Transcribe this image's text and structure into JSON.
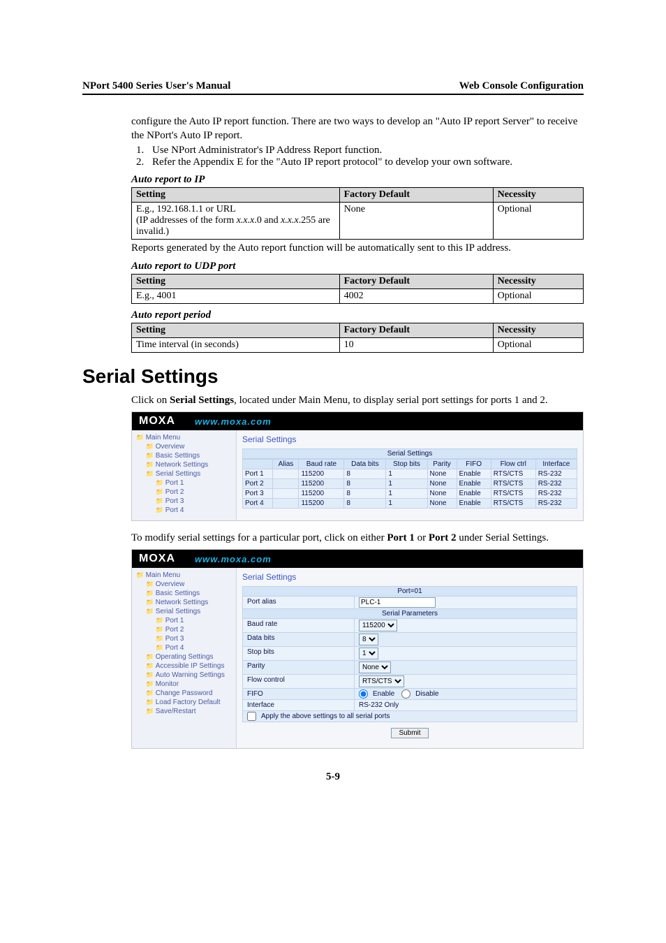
{
  "header": {
    "left": "NPort 5400 Series User's Manual",
    "right": "Web Console Configuration"
  },
  "intro": {
    "p1": "configure the Auto IP report function. There are two ways to develop an \"Auto IP report Server\" to receive the NPort's Auto IP report.",
    "li1": "Use NPort Administrator's IP Address Report function.",
    "li2": "Refer the Appendix E for the \"Auto IP report protocol\" to develop your own software."
  },
  "sub1": {
    "title": "Auto report to IP",
    "h_setting": "Setting",
    "h_default": "Factory Default",
    "h_necessity": "Necessity",
    "row1_setting_a": "E.g., 192.168.1.1 or URL",
    "row1_setting_b": "(IP addresses of the form x.x.x.0 and x.x.x.255 are invalid.)",
    "row1_default": "None",
    "row1_necessity": "Optional",
    "after": "Reports generated by the Auto report function will be automatically sent to this IP address."
  },
  "sub2": {
    "title": "Auto report to UDP port",
    "h_setting": "Setting",
    "h_default": "Factory Default",
    "h_necessity": "Necessity",
    "row1_setting": "E.g., 4001",
    "row1_default": "4002",
    "row1_necessity": "Optional"
  },
  "sub3": {
    "title": "Auto report period",
    "h_setting": "Setting",
    "h_default": "Factory Default",
    "h_necessity": "Necessity",
    "row1_setting": "Time interval (in seconds)",
    "row1_default": "10",
    "row1_necessity": "Optional"
  },
  "section_title": "Serial Settings",
  "section_p1": "Click on Serial Settings, located under Main Menu, to display serial port settings for ports 1 and 2.",
  "section_p2": "To modify serial settings for a particular port, click on either Port 1 or Port 2 under Serial Settings.",
  "moxa": {
    "logo": "MOXA",
    "url": "www.moxa.com"
  },
  "shot1": {
    "side": [
      "Main Menu",
      "Overview",
      "Basic Settings",
      "Network Settings",
      "Serial Settings",
      "Port 1",
      "Port 2",
      "Port 3",
      "Port 4"
    ],
    "title": "Serial Settings",
    "section": "Serial Settings",
    "cols": [
      "",
      "Alias",
      "Baud rate",
      "Data bits",
      "Stop bits",
      "Parity",
      "FIFO",
      "Flow ctrl",
      "Interface"
    ],
    "rows": [
      [
        "Port 1",
        "",
        "115200",
        "8",
        "1",
        "None",
        "Enable",
        "RTS/CTS",
        "RS-232"
      ],
      [
        "Port 2",
        "",
        "115200",
        "8",
        "1",
        "None",
        "Enable",
        "RTS/CTS",
        "RS-232"
      ],
      [
        "Port 3",
        "",
        "115200",
        "8",
        "1",
        "None",
        "Enable",
        "RTS/CTS",
        "RS-232"
      ],
      [
        "Port 4",
        "",
        "115200",
        "8",
        "1",
        "None",
        "Enable",
        "RTS/CTS",
        "RS-232"
      ]
    ]
  },
  "shot2": {
    "side": [
      "Main Menu",
      "Overview",
      "Basic Settings",
      "Network Settings",
      "Serial Settings",
      "Port 1",
      "Port 2",
      "Port 3",
      "Port 4",
      "Operating Settings",
      "Accessible IP Settings",
      "Auto Warning Settings",
      "Monitor",
      "Change Password",
      "Load Factory Default",
      "Save/Restart"
    ],
    "title": "Serial Settings",
    "port_header": "Port=01",
    "params_header": "Serial Parameters",
    "form": {
      "port_alias_label": "Port alias",
      "port_alias_value": "PLC-1",
      "baud_label": "Baud rate",
      "baud_value": "115200",
      "data_label": "Data bits",
      "data_value": "8",
      "stop_label": "Stop bits",
      "stop_value": "1",
      "parity_label": "Parity",
      "parity_value": "None",
      "flow_label": "Flow control",
      "flow_value": "RTS/CTS",
      "fifo_label": "FIFO",
      "fifo_enable": "Enable",
      "fifo_disable": "Disable",
      "iface_label": "Interface",
      "iface_value": "RS-232 Only",
      "apply_label": "Apply the above settings to all serial ports"
    },
    "submit": "Submit"
  },
  "page_num": "5-9"
}
